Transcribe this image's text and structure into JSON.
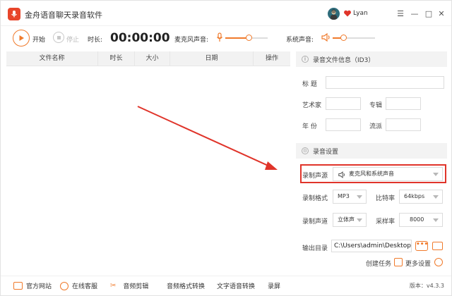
{
  "app": {
    "title": "金舟语音聊天录音软件",
    "user": "Lyan"
  },
  "window_controls": {
    "menu": "☰",
    "minimize": "—",
    "maximize": "□",
    "close": "✕"
  },
  "toolbar": {
    "start_label": "开始",
    "stop_label": "停止",
    "duration_label": "时长:",
    "duration_value": "00:00:00",
    "mic_label": "麦克风声音:",
    "mic_level": 0.55,
    "system_label": "系统声音:",
    "system_level": 0.25
  },
  "table": {
    "columns": [
      "文件名称",
      "时长",
      "大小",
      "日期",
      "操作"
    ],
    "rows": []
  },
  "id3": {
    "header": "录音文件信息（ID3）",
    "title_label": "标    题",
    "artist_label": "艺术家",
    "album_label": "专辑",
    "year_label": "年    份",
    "genre_label": "流派"
  },
  "settings": {
    "header": "录音设置",
    "source_label": "录制声源",
    "source_value": "麦克风和系统声音",
    "format_label": "录制格式",
    "format_value": "MP3",
    "bitrate_label": "比特率",
    "bitrate_value": "64kbps",
    "channel_label": "录制声道",
    "channel_value": "立体声",
    "samplerate_label": "采样率",
    "samplerate_value": "8000",
    "output_label": "输出目录",
    "output_value": "C:\\Users\\admin\\Desktop\\",
    "browse_label": "•••",
    "create_task": "创建任务",
    "more_settings": "更多设置"
  },
  "bottom": {
    "items": [
      "官方网站",
      "在线客服",
      "音频剪辑",
      "音频格式转换",
      "文字语音转换",
      "录屏"
    ],
    "version": "版本：v4.3.3"
  },
  "colors": {
    "accent": "#f07a2b",
    "highlight": "#e0342a",
    "logo": "#e8452a"
  },
  "icons": [
    "mic-logo-icon",
    "avatar",
    "heart-icon",
    "menu-icon",
    "minimize-icon",
    "maximize-icon",
    "close-icon",
    "play-icon",
    "stop-icon",
    "microphone-icon",
    "speaker-icon",
    "info-icon",
    "gear-icon",
    "folder-icon",
    "globe-icon",
    "headset-icon",
    "scissors-icon",
    "edit-icon"
  ]
}
